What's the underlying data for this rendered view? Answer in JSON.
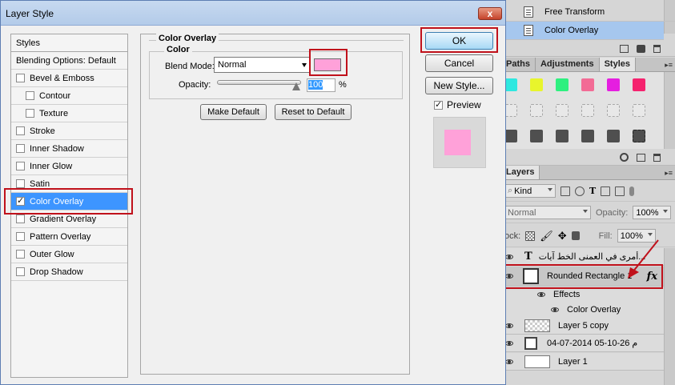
{
  "dialog": {
    "title": "Layer Style",
    "close_symbol": "x",
    "styles_list": {
      "header": "Styles",
      "blending": "Blending Options: Default",
      "items": [
        {
          "label": "Bevel & Emboss",
          "checked": false,
          "sub": false
        },
        {
          "label": "Contour",
          "checked": false,
          "sub": true
        },
        {
          "label": "Texture",
          "checked": false,
          "sub": true
        },
        {
          "label": "Stroke",
          "checked": false,
          "sub": false
        },
        {
          "label": "Inner Shadow",
          "checked": false,
          "sub": false
        },
        {
          "label": "Inner Glow",
          "checked": false,
          "sub": false
        },
        {
          "label": "Satin",
          "checked": false,
          "sub": false
        },
        {
          "label": "Color Overlay",
          "checked": true,
          "sub": false,
          "selected": true
        },
        {
          "label": "Gradient Overlay",
          "checked": false,
          "sub": false
        },
        {
          "label": "Pattern Overlay",
          "checked": false,
          "sub": false
        },
        {
          "label": "Outer Glow",
          "checked": false,
          "sub": false
        },
        {
          "label": "Drop Shadow",
          "checked": false,
          "sub": false
        }
      ]
    },
    "overlay": {
      "group_title": "Color Overlay",
      "sub_group_title": "Color",
      "blend_mode_label": "Blend Mode:",
      "blend_mode_value": "Normal",
      "color_hex": "#ffa1d9",
      "opacity_label": "Opacity:",
      "opacity_value": "100",
      "opacity_unit": "%",
      "opacity_level": 1.0,
      "make_default": "Make Default",
      "reset_default": "Reset to Default"
    },
    "buttons": {
      "ok": "OK",
      "cancel": "Cancel",
      "new_style": "New Style...",
      "preview_label": "Preview",
      "preview_checked": true
    }
  },
  "history": {
    "items": [
      "Free Transform",
      "Color Overlay"
    ],
    "selected": "Color Overlay"
  },
  "styles_panel": {
    "tabs": [
      "Paths",
      "Adjustments",
      "Styles"
    ],
    "active_tab": "Styles",
    "swatch_colors": [
      "#2ee8e0",
      "#e8f52c",
      "#2ef07f",
      "#f26b95",
      "#e51ee0",
      "#f5226e"
    ]
  },
  "layers_panel": {
    "title": "Layers",
    "kind_label": "Kind",
    "mode": "Normal",
    "opacity_label": "Opacity:",
    "opacity_value": "100%",
    "lock_label": "ock:",
    "fill_label": "Fill:",
    "fill_value": "100%",
    "layers": [
      {
        "name": "...أمرى في العمنى الخط آيات",
        "type": "text"
      },
      {
        "name": "Rounded Rectangle 1",
        "type": "shape",
        "fx": "fx",
        "selected": true
      },
      {
        "name": "Effects",
        "type": "effects"
      },
      {
        "name": "Color Overlay",
        "type": "effect"
      },
      {
        "name": "Layer 5 copy",
        "type": "pixel"
      },
      {
        "name": "04-07-2014  05-10-26 م",
        "type": "smart"
      },
      {
        "name": "Layer 1",
        "type": "pixel"
      }
    ]
  }
}
